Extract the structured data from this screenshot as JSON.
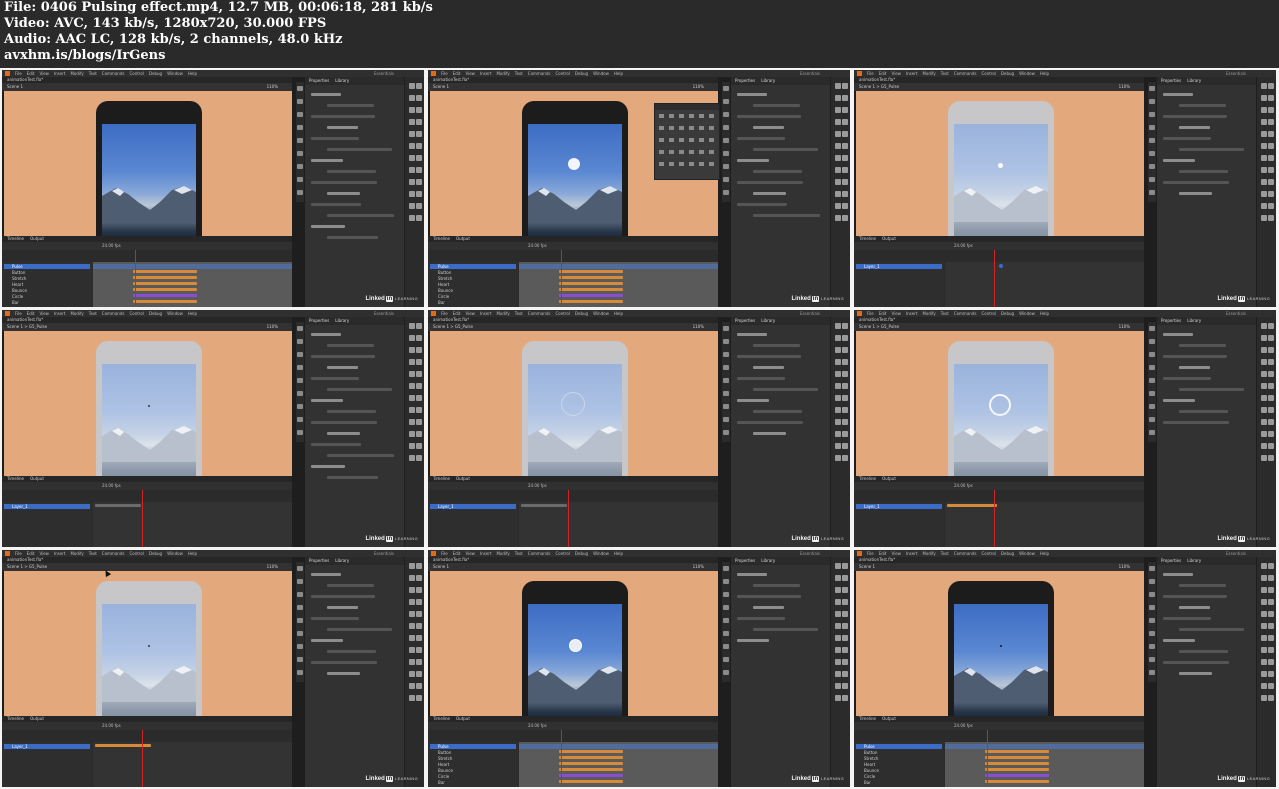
{
  "header": {
    "file_line": "File: 0406 Pulsing effect.mp4, 12.7 MB, 00:06:18, 281 kb/s",
    "video_line": "Video: AVC, 143 kb/s, 1280x720, 30.000 FPS",
    "audio_line": "Audio: AAC LC, 128 kb/s, 2 channels, 48.0 kHz",
    "site_line": "avxhm.is/blogs/IrGens"
  },
  "app": {
    "menu": [
      "File",
      "Edit",
      "View",
      "Insert",
      "Modify",
      "Text",
      "Commands",
      "Control",
      "Debug",
      "Window",
      "Help"
    ],
    "workspace_label": "Essentials",
    "doc_tab": "animationTest.fla*",
    "zoom": "110%",
    "panel_tabs": [
      "Properties",
      "Library"
    ],
    "timeline_tabs": [
      "Timeline",
      "Output"
    ],
    "fps": "24.00 fps"
  },
  "thumbnails": [
    {
      "scene": "Scene 1",
      "stage": "full",
      "dot": "none",
      "tween": "multi",
      "layers": [
        "Pulse",
        "Button",
        "Stretch",
        "Heart",
        "Bounce",
        "Circle",
        "Bar"
      ],
      "panel": "fill-stroke"
    },
    {
      "scene": "Scene 1",
      "stage": "full",
      "dot": "white",
      "tween": "multi",
      "layers": [
        "Pulse",
        "Button",
        "Stretch",
        "Heart",
        "Bounce",
        "Circle",
        "Bar"
      ],
      "panel": "position-size",
      "popup": "align"
    },
    {
      "scene": "Scene 1  >  G5_Pulse",
      "stage": "faded",
      "dot": "small",
      "tween": "keyframe",
      "layers": [
        "Layer_1"
      ],
      "panel": "document"
    },
    {
      "scene": "Scene 1  >  G5_Pulse",
      "stage": "faded",
      "dot": "tiny",
      "tween": "none",
      "layers": [
        "Layer_1"
      ],
      "panel": "fill-stroke"
    },
    {
      "scene": "Scene 1  >  G5_Pulse",
      "stage": "faded",
      "dot": "ring-faint",
      "tween": "none",
      "layers": [
        "Layer_1"
      ],
      "panel": "document"
    },
    {
      "scene": "Scene 1  >  G5_Pulse",
      "stage": "faded",
      "dot": "ring",
      "tween": "orange",
      "layers": [
        "Layer_1"
      ],
      "panel": "tween"
    },
    {
      "scene": "Scene 1  >  G5_Pulse",
      "stage": "faded",
      "dot": "tiny",
      "tween": "orange-long",
      "layers": [
        "Layer_1"
      ],
      "panel": "document"
    },
    {
      "scene": "Scene 1",
      "stage": "full",
      "dot": "pulse",
      "tween": "multi",
      "layers": [
        "Pulse",
        "Button",
        "Stretch",
        "Heart",
        "Bounce",
        "Circle",
        "Bar"
      ],
      "panel": "color-effect"
    },
    {
      "scene": "Scene 1",
      "stage": "full",
      "dot": "tiny-dark",
      "tween": "multi",
      "layers": [
        "Pulse",
        "Button",
        "Stretch",
        "Heart",
        "Bounce",
        "Circle",
        "Bar"
      ],
      "panel": "document"
    }
  ],
  "watermark": {
    "brand": "Linked",
    "in": "in",
    "suffix": "LEARNING"
  },
  "colors": {
    "stage": "#e3a87b",
    "tween_orange": "#d68a3a",
    "tween_purple": "#8a4fd0",
    "playhead": "#d32424",
    "selected_layer": "#3a6cc8"
  }
}
